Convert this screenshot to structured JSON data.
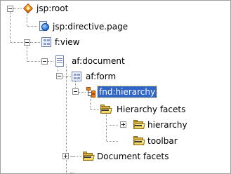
{
  "tree": {
    "nodes": [
      {
        "id": "root",
        "label": "jsp:root",
        "icon": "jsp-root-icon",
        "expander": "minus"
      },
      {
        "id": "directive",
        "label": "jsp:directive.page",
        "icon": "jsp-directive-icon",
        "expander": "none"
      },
      {
        "id": "view",
        "label": "f:view",
        "icon": "faces-view-icon",
        "expander": "minus"
      },
      {
        "id": "document",
        "label": "af:document",
        "icon": "document-icon",
        "expander": "minus"
      },
      {
        "id": "form",
        "label": "af:form",
        "icon": "form-icon",
        "expander": "minus"
      },
      {
        "id": "hierarchy",
        "label": "fnd:hierarchy",
        "icon": "hierarchy-icon",
        "expander": "minus",
        "selected": true
      },
      {
        "id": "hier-facets",
        "label": "Hierarchy facets",
        "icon": "folder-icon",
        "expander": "minus"
      },
      {
        "id": "facet-hierarchy",
        "label": "hierarchy",
        "icon": "folder-icon",
        "expander": "plus"
      },
      {
        "id": "facet-toolbar",
        "label": "toolbar",
        "icon": "folder-icon",
        "expander": "none"
      },
      {
        "id": "doc-facets",
        "label": "Document facets",
        "icon": "folder-icon",
        "expander": "plus"
      }
    ],
    "colors": {
      "selection": "#2f65c5",
      "selection_text": "#ffffff",
      "connector": "#8c8c8c"
    }
  }
}
